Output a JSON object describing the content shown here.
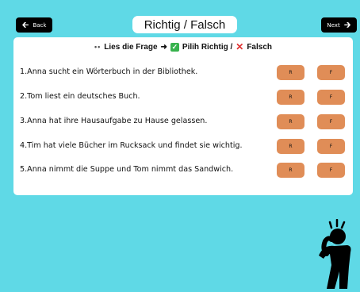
{
  "nav": {
    "back_label": "Back",
    "next_label": "Next"
  },
  "title": "Richtig / Falsch",
  "instruction": {
    "dots": "••",
    "part1": "Lies die Frage",
    "arrow": "➜",
    "part2": "Pilih Richtig /",
    "part3": "Falsch"
  },
  "questions": [
    {
      "text": "1.Anna sucht ein Wörterbuch in der Bibliothek.",
      "r_label": "R",
      "f_label": "F"
    },
    {
      "text": "2.Tom liest ein deutsches Buch.",
      "r_label": "R",
      "f_label": "F"
    },
    {
      "text": "3.Anna hat ihre Hausaufgabe zu Hause gelassen.",
      "r_label": "R",
      "f_label": "F"
    },
    {
      "text": "4.Tim hat viele Bücher im Rucksack und findet sie wichtig.",
      "r_label": "R",
      "f_label": "F"
    },
    {
      "text": "5.Anna nimmt die Suppe und Tom nimmt das Sandwich.",
      "r_label": "R",
      "f_label": "F"
    }
  ],
  "colors": {
    "background": "#5fd9e6",
    "answer_button": "#e08d57",
    "check": "#37b24d",
    "cross": "#e03131"
  },
  "icons": {
    "back": "arrow-left-icon",
    "next": "arrow-right-icon",
    "check": "check-box-icon",
    "cross": "cross-icon",
    "figure": "confused-person-icon"
  }
}
